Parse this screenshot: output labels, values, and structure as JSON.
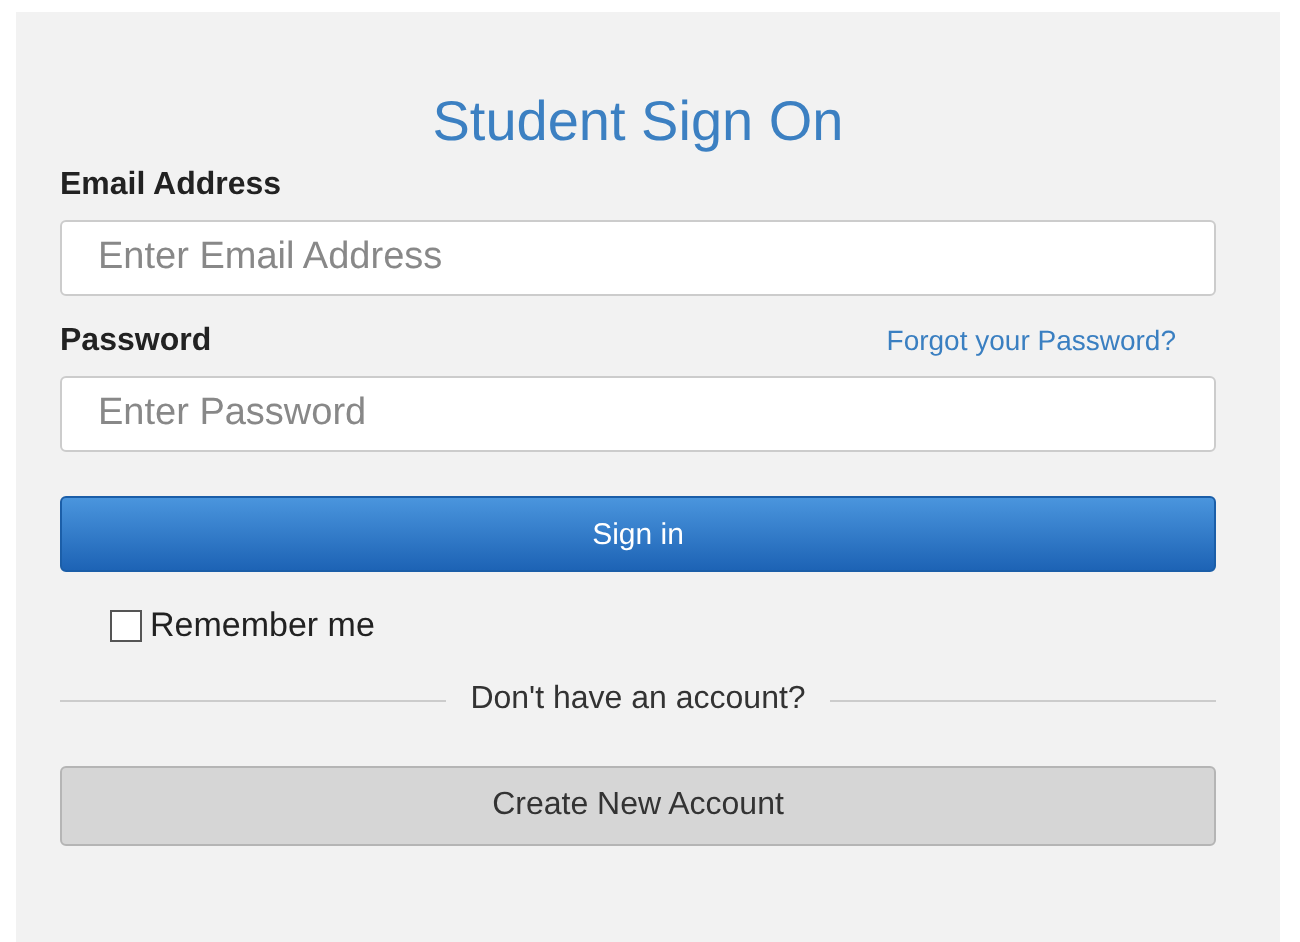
{
  "title": "Student Sign On",
  "email": {
    "label": "Email Address",
    "placeholder": "Enter Email Address"
  },
  "password": {
    "label": "Password",
    "placeholder": "Enter Password",
    "forgot_link": "Forgot your Password?"
  },
  "sign_in_button": "Sign in",
  "remember": {
    "label": "Remember me",
    "checked": false
  },
  "divider_text": "Don't have an account?",
  "create_button": "Create New Account"
}
